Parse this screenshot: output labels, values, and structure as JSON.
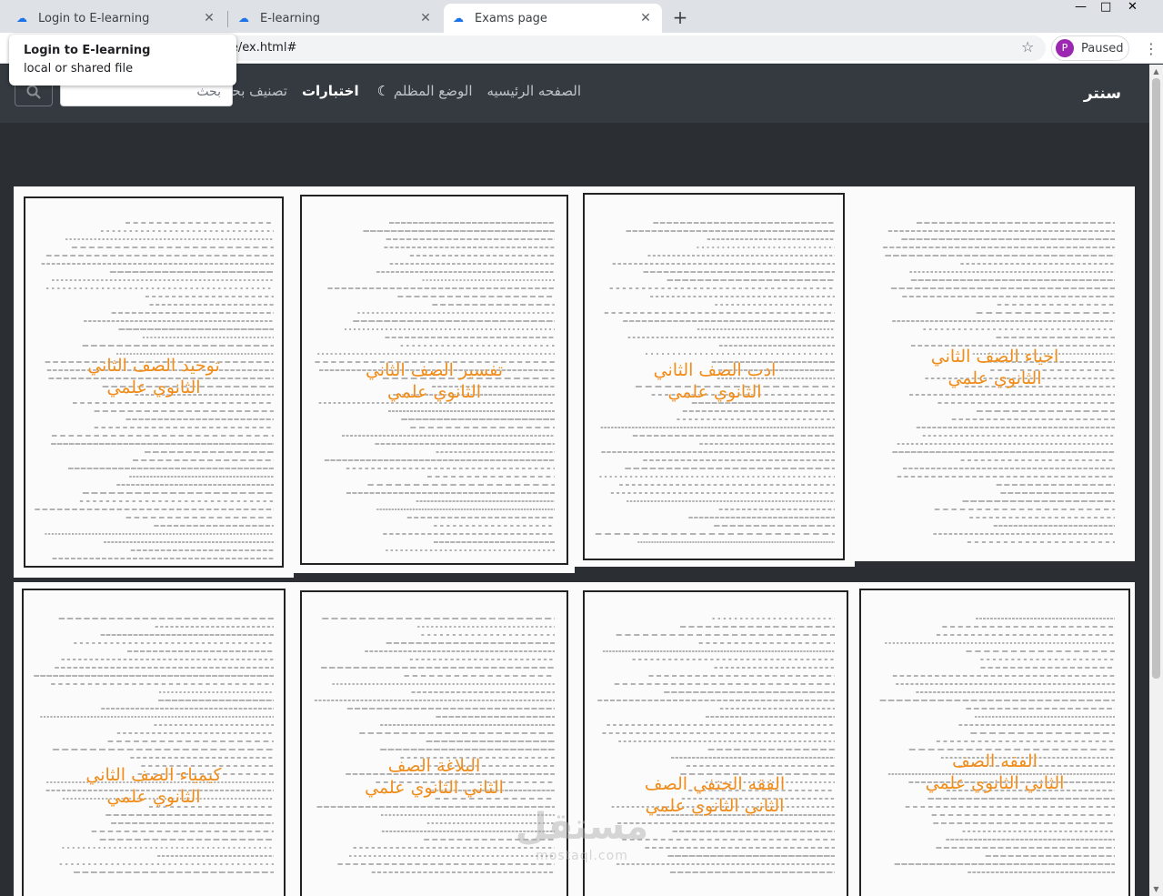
{
  "browser": {
    "tabs": [
      {
        "label": "Login to E-learning",
        "active": false
      },
      {
        "label": "E-learning",
        "active": false
      },
      {
        "label": "Exams page",
        "active": true
      }
    ],
    "new_tab_icon": "plus-icon",
    "address": "File  |  E:/project/ee/ex.html#",
    "tooltip_title": "Login to E-learning",
    "tooltip_sub": "local or shared file",
    "profile_letter": "P",
    "profile_status": "Paused",
    "window_controls": [
      "—",
      "□",
      "✕"
    ]
  },
  "navbar": {
    "brand": "سنتر",
    "links": [
      "الصفحه الرئيسيه",
      "الوضع المظلم",
      "اختبارات",
      "تصنيف بحسب"
    ],
    "search_placeholder": "بحث",
    "search_icon": "search-icon"
  },
  "exams": [
    {
      "line1": "توحيد الصف الثاني",
      "line2": "الثانوي علمي"
    },
    {
      "line1": "تفسير الصف الثاني",
      "line2": "الثانوي علمي"
    },
    {
      "line1": "ادب الصف الثاني",
      "line2": "الثانوي علمي"
    },
    {
      "line1": "احياء الصف الثاني",
      "line2": "الثانوي علمي"
    },
    {
      "line1": "كيمياء الصف الثاني",
      "line2": "الثانوي علمي"
    },
    {
      "line1": "البلاغة الصف",
      "line2": "الثاني الثانوي علمي"
    },
    {
      "line1": "الفقه الحنفي الصف",
      "line2": "الثاني الثانوي علمي"
    },
    {
      "line1": "الفقه الصف",
      "line2": "الثاني الثانوي علمي"
    }
  ],
  "watermark": {
    "arabic": "مستقل",
    "latin": "mostaql.com"
  }
}
